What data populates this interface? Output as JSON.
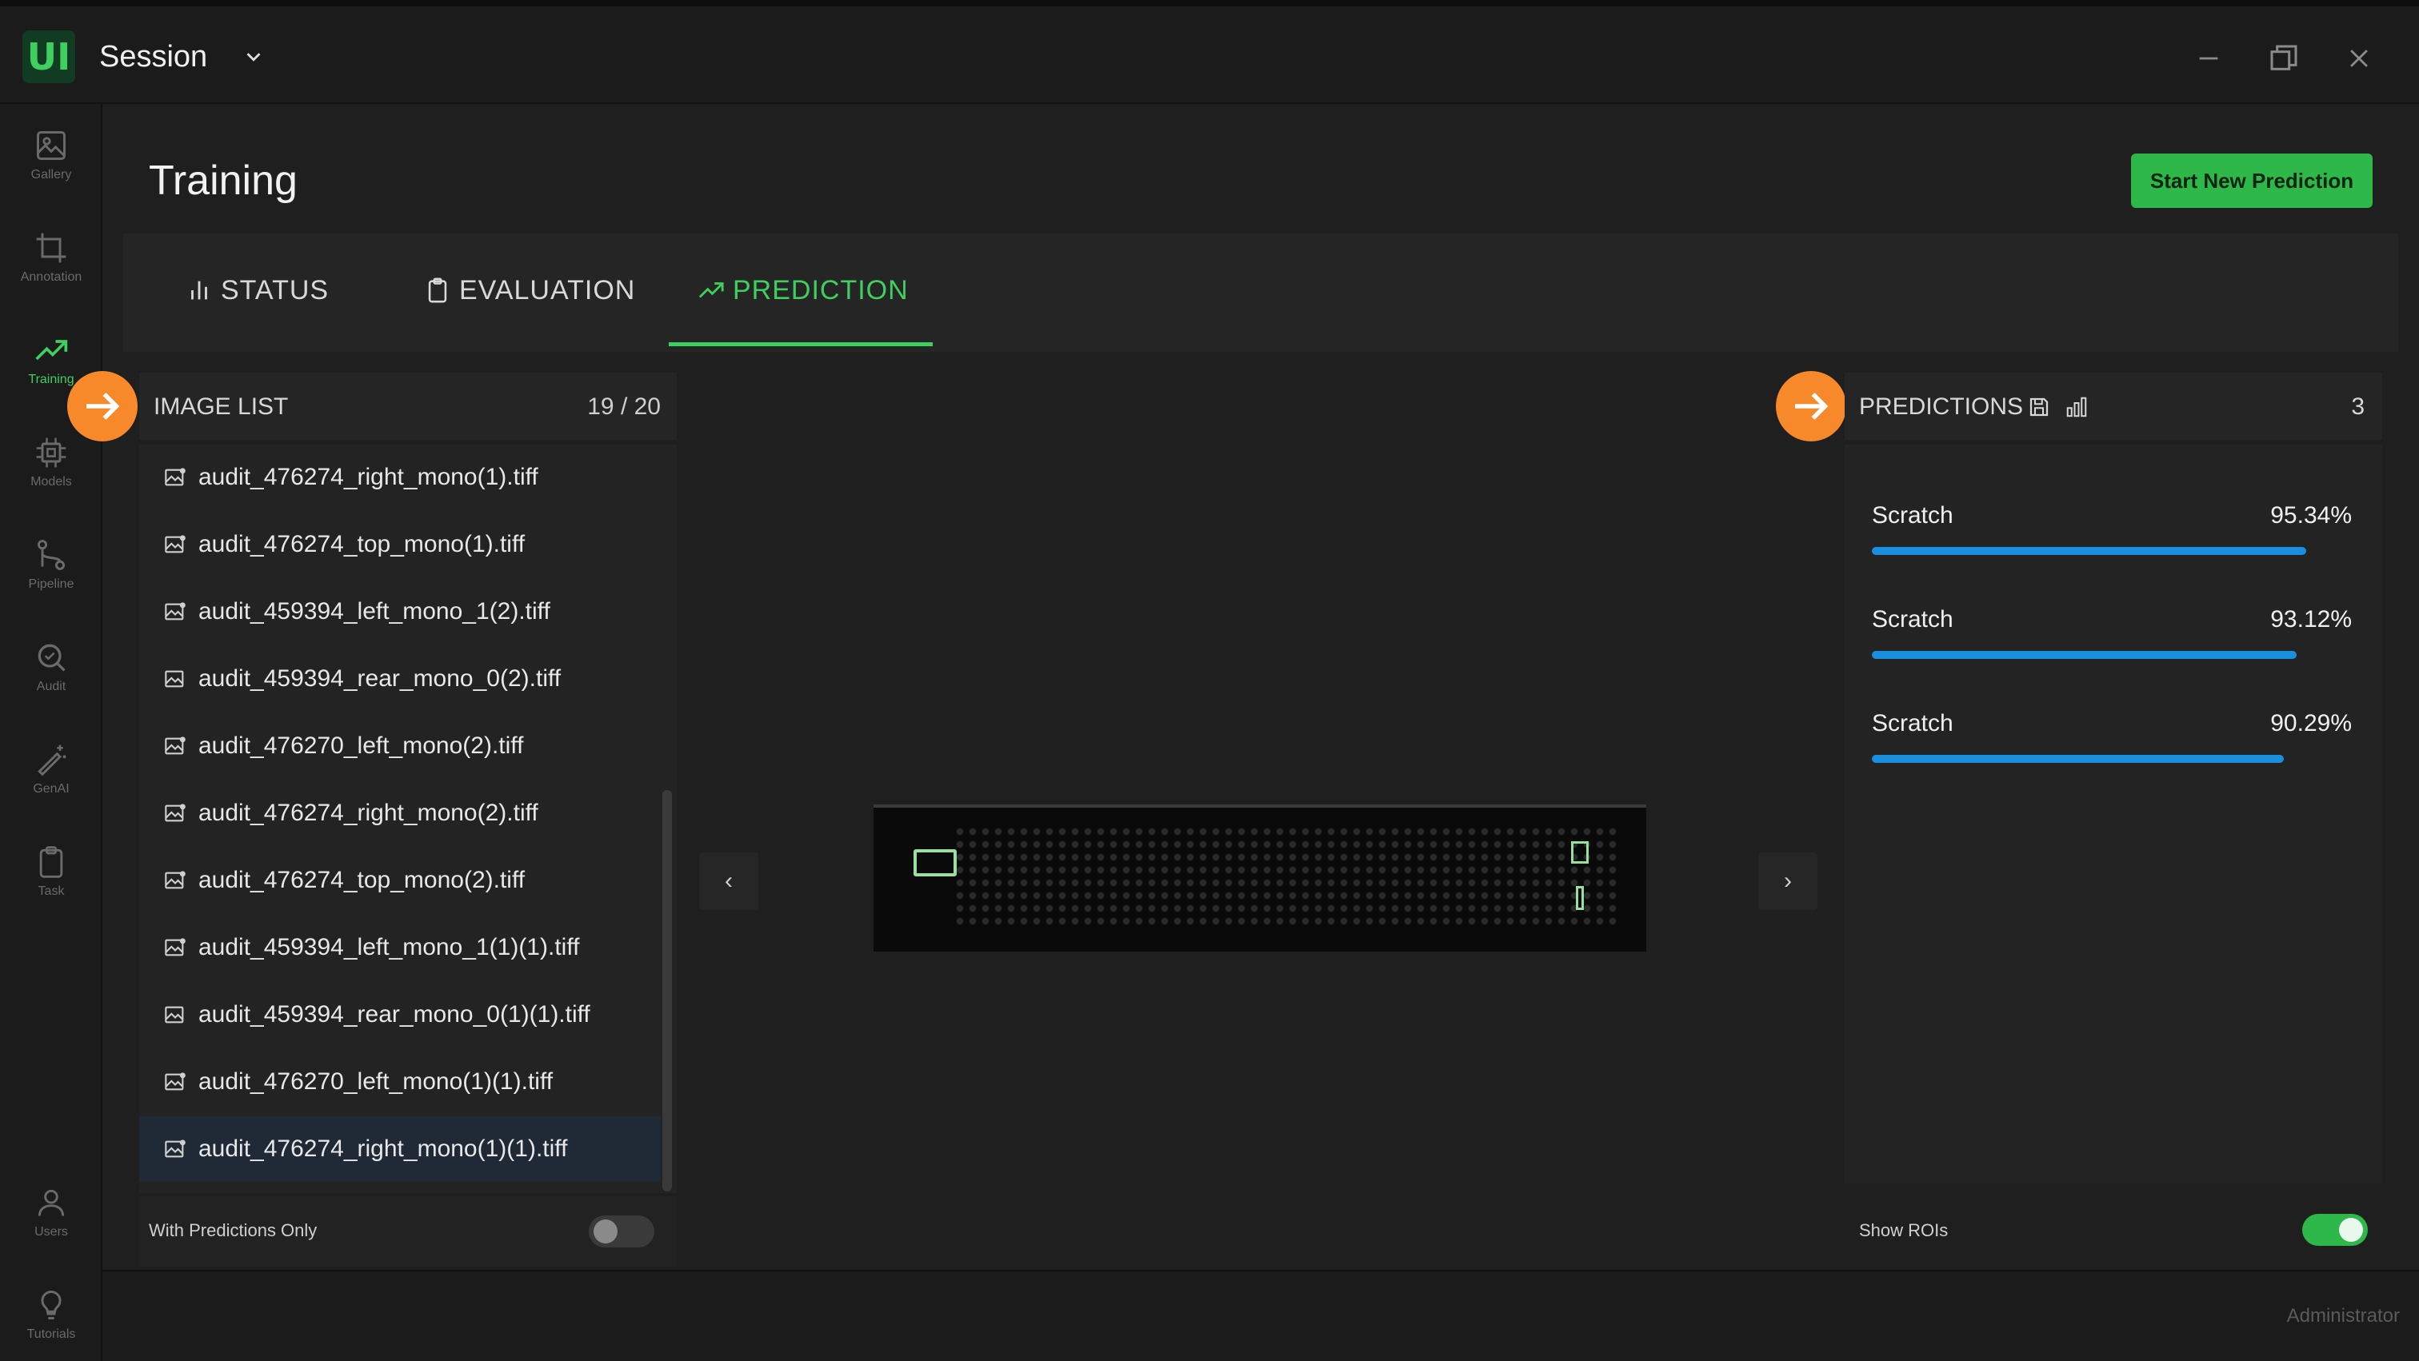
{
  "app": {
    "logo_text": "UI",
    "session_label": "Session"
  },
  "sidebar": {
    "items": [
      {
        "label": "Gallery",
        "icon": "image-icon"
      },
      {
        "label": "Annotation",
        "icon": "crop-icon"
      },
      {
        "label": "Training",
        "icon": "trending-up-icon",
        "active": true
      },
      {
        "label": "Models",
        "icon": "chip-icon"
      },
      {
        "label": "Pipeline",
        "icon": "git-branch-icon"
      },
      {
        "label": "Audit",
        "icon": "magnify-icon"
      },
      {
        "label": "GenAI",
        "icon": "magic-wand-icon"
      },
      {
        "label": "Task",
        "icon": "clipboard-icon"
      },
      {
        "label": "Users",
        "icon": "user-icon"
      },
      {
        "label": "Tutorials",
        "icon": "lightbulb-icon"
      }
    ]
  },
  "page": {
    "title": "Training",
    "start_button": "Start New Prediction"
  },
  "tabs": [
    {
      "label": "STATUS",
      "icon": "bar-chart-icon"
    },
    {
      "label": "EVALUATION",
      "icon": "clipboard-icon"
    },
    {
      "label": "PREDICTION",
      "icon": "trending-up-icon",
      "active": true
    }
  ],
  "image_list": {
    "title": "IMAGE LIST",
    "count": "19 / 20",
    "items": [
      "audit_476274_right_mono(1).tiff",
      "audit_476274_top_mono(1).tiff",
      "audit_459394_left_mono_1(2).tiff",
      "audit_459394_rear_mono_0(2).tiff",
      "audit_476270_left_mono(2).tiff",
      "audit_476274_right_mono(2).tiff",
      "audit_476274_top_mono(2).tiff",
      "audit_459394_left_mono_1(1)(1).tiff",
      "audit_459394_rear_mono_0(1)(1).tiff",
      "audit_476270_left_mono(1)(1).tiff",
      "audit_476274_right_mono(1)(1).tiff"
    ],
    "selected_index": 10,
    "footer_label": "With Predictions Only",
    "footer_toggle_on": false
  },
  "viewer": {
    "prev_glyph": "‹",
    "next_glyph": "›"
  },
  "predictions": {
    "title": "PREDICTIONS",
    "count": "3",
    "items": [
      {
        "label": "Scratch",
        "value": "95.34%",
        "fraction": 0.9534
      },
      {
        "label": "Scratch",
        "value": "93.12%",
        "fraction": 0.9312
      },
      {
        "label": "Scratch",
        "value": "90.29%",
        "fraction": 0.9029
      }
    ],
    "footer_label": "Show ROIs",
    "footer_toggle_on": true
  },
  "status_bar": {
    "user_role": "Administrator"
  },
  "colors": {
    "accent_green": "#3fcf5e",
    "button_green": "#2fb84a",
    "progress_blue": "#1a8fe0",
    "marker_orange": "#f7892b"
  }
}
